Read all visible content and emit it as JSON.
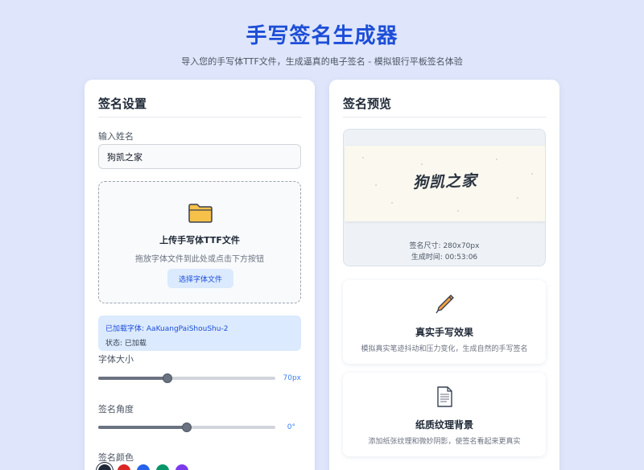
{
  "header": {
    "title": "手写签名生成器",
    "subtitle": "导入您的手写体TTF文件，生成逼真的电子签名 - 模拟银行平板签名体验"
  },
  "settings": {
    "title": "签名设置",
    "name_label": "输入姓名",
    "name_value": "狗凯之家",
    "upload": {
      "icon": "folder-icon",
      "title": "上传手写体TTF文件",
      "hint": "拖放字体文件到此处或点击下方按钮",
      "button": "选择字体文件"
    },
    "font_info": {
      "loaded_line": "已加载字体: AaKuangPaiShouShu-2",
      "status_line": "状态: 已加载"
    },
    "size": {
      "label": "字体大小",
      "value_text": "70px",
      "fraction": 0.39
    },
    "angle": {
      "label": "签名角度",
      "value_text": "0°",
      "fraction": 0.5
    },
    "color": {
      "label": "签名颜色",
      "swatches": [
        "#1f2937",
        "#dc2626",
        "#2563eb",
        "#059669",
        "#7c3aed"
      ],
      "selected_index": 0
    }
  },
  "preview": {
    "title": "签名预览",
    "signature_text": "狗凯之家",
    "size_line": "签名尺寸: 280x70px",
    "time_line": "生成时间: 00:53:06"
  },
  "features": [
    {
      "icon": "pen-icon",
      "title": "真实手写效果",
      "desc": "模拟真实笔迹抖动和压力变化，生成自然的手写签名"
    },
    {
      "icon": "document-icon",
      "title": "纸质纹理背景",
      "desc": "添加纸张纹理和微妙阴影，使签名看起来更真实"
    }
  ],
  "colors": {
    "brand": "#1d4ed8",
    "page_bg": "#dfe6fb",
    "info_bg": "#dbeafe"
  }
}
